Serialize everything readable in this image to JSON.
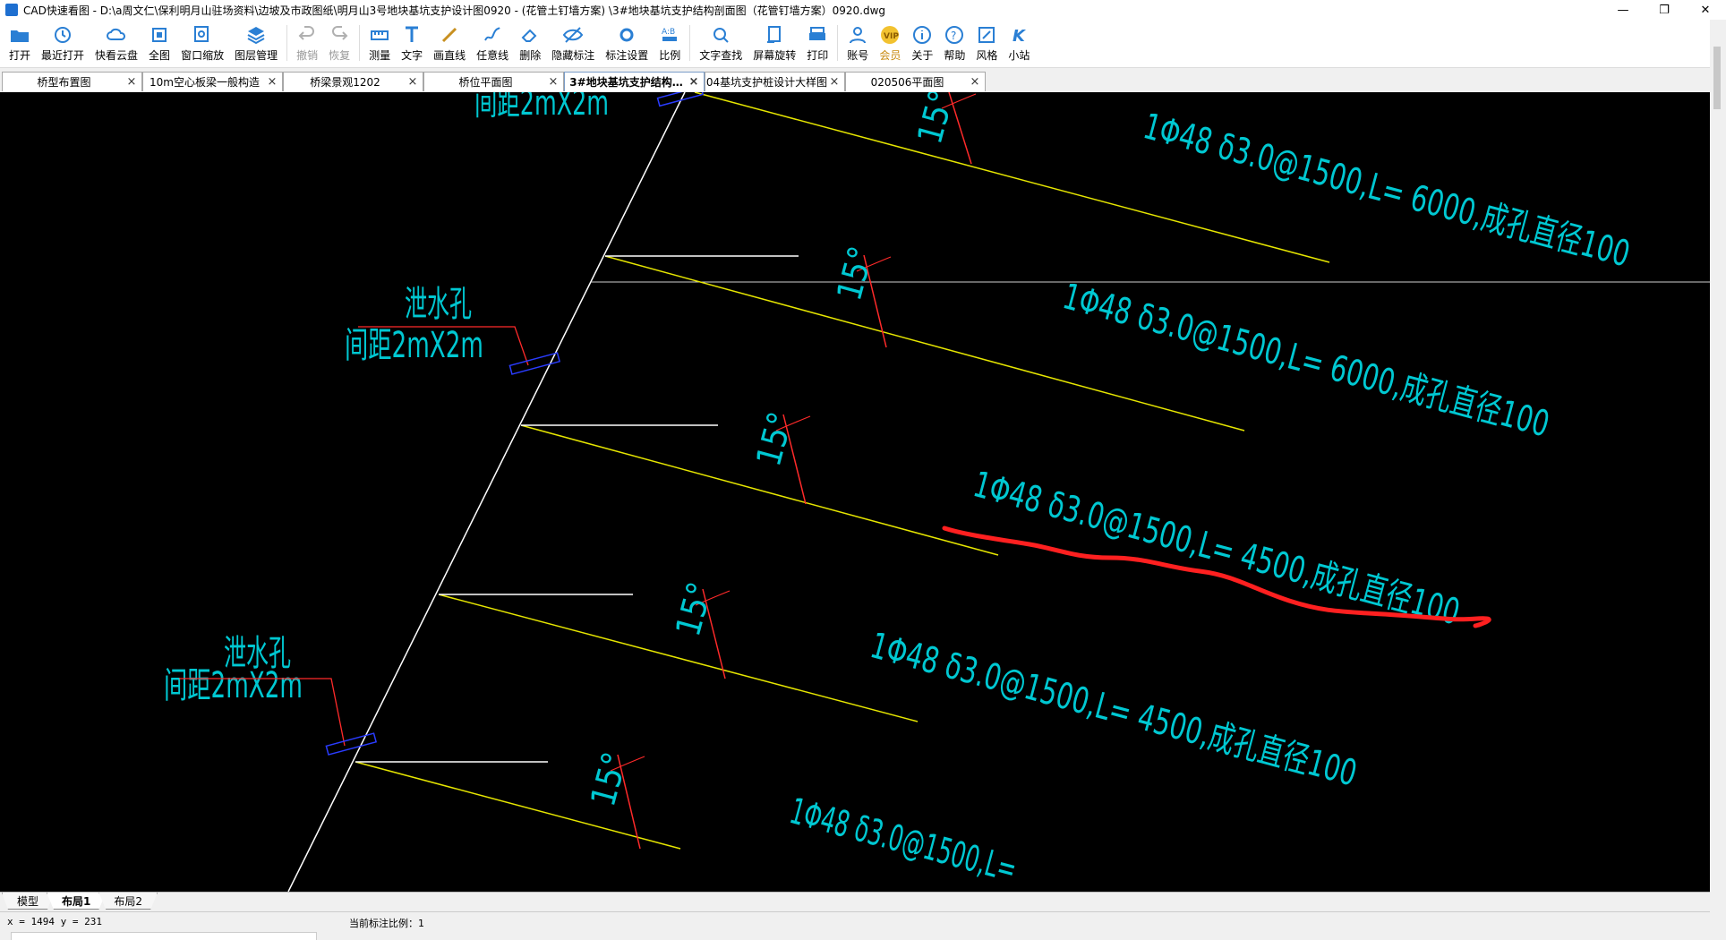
{
  "window": {
    "title": "CAD快速看图 - D:\\a周文仁\\保利明月山驻场资料\\边坡及市政图纸\\明月山3号地块基坑支护设计图0920 - (花管土钉墙方案) \\3#地块基坑支护结构剖面图（花管钉墙方案）0920.dwg",
    "minimize": "—",
    "restore": "❐",
    "close": "✕"
  },
  "toolbar": {
    "items": [
      {
        "label": "打开",
        "icon": "folder-open-icon"
      },
      {
        "label": "最近打开",
        "icon": "recent-icon"
      },
      {
        "label": "快看云盘",
        "icon": "cloud-icon"
      },
      {
        "label": "全图",
        "icon": "fit-all-icon"
      },
      {
        "label": "窗口缩放",
        "icon": "window-zoom-icon"
      },
      {
        "label": "图层管理",
        "icon": "layers-icon"
      },
      {
        "label": "撤销",
        "icon": "undo-icon"
      },
      {
        "label": "恢复",
        "icon": "redo-icon"
      },
      {
        "label": "测量",
        "icon": "measure-icon"
      },
      {
        "label": "文字",
        "icon": "text-icon"
      },
      {
        "label": "画直线",
        "icon": "line-icon"
      },
      {
        "label": "任意线",
        "icon": "freehand-icon"
      },
      {
        "label": "删除",
        "icon": "eraser-icon"
      },
      {
        "label": "隐藏标注",
        "icon": "hide-eye-icon"
      },
      {
        "label": "标注设置",
        "icon": "annotation-settings-icon"
      },
      {
        "label": "比例",
        "icon": "scale-icon"
      },
      {
        "label": "文字查找",
        "icon": "text-search-icon"
      },
      {
        "label": "屏幕旋转",
        "icon": "rotate-screen-icon"
      },
      {
        "label": "打印",
        "icon": "printer-icon"
      },
      {
        "label": "账号",
        "icon": "user-icon"
      },
      {
        "label": "会员",
        "icon": "vip-icon"
      },
      {
        "label": "关于",
        "icon": "info-icon"
      },
      {
        "label": "帮助",
        "icon": "help-icon"
      },
      {
        "label": "风格",
        "icon": "style-icon"
      },
      {
        "label": "小站",
        "icon": "k-icon"
      }
    ],
    "disabled_labels": [
      "撤销",
      "恢复"
    ]
  },
  "tabs": [
    {
      "label": "桥型布置图"
    },
    {
      "label": "10m空心板梁一般构造"
    },
    {
      "label": "桥梁景观1202"
    },
    {
      "label": "桥位平面图"
    },
    {
      "label": "3#地块基坑支护结构…"
    },
    {
      "label": "04基坑支护桩设计大样图"
    },
    {
      "label": "020506平面图"
    }
  ],
  "active_tab_label": "3#地块基坑支护结构…",
  "drawing": {
    "nail_labels": [
      "1Φ48 δ3.0@1500,L= 6000,成孔直径100",
      "1Φ48 δ3.0@1500,L= 6000,成孔直径100",
      "1Φ48 δ3.0@1500,L= 4500,成孔直径100",
      "1Φ48 δ3.0@1500,L= 4500,成孔直径100",
      "1Φ48 δ3.0@1500,L="
    ],
    "angle_label": "15°",
    "drain_title": "泄水孔",
    "drain_spacing": "间距2mX2m",
    "colors": {
      "background": "#000000",
      "nail_line": "#e6e600",
      "text": "#00c8d2",
      "dimension": "#ff2a2a",
      "slope": "#ffffff",
      "drain_symbol": "#2a3cff",
      "markup": "#ff2020"
    }
  },
  "layout_tabs": [
    {
      "label": "模型"
    },
    {
      "label": "布局1"
    },
    {
      "label": "布局2"
    }
  ],
  "active_layout_label": "布局1",
  "status": {
    "coords": "x = 1494  y = 231",
    "scale": "当前标注比例：1"
  }
}
